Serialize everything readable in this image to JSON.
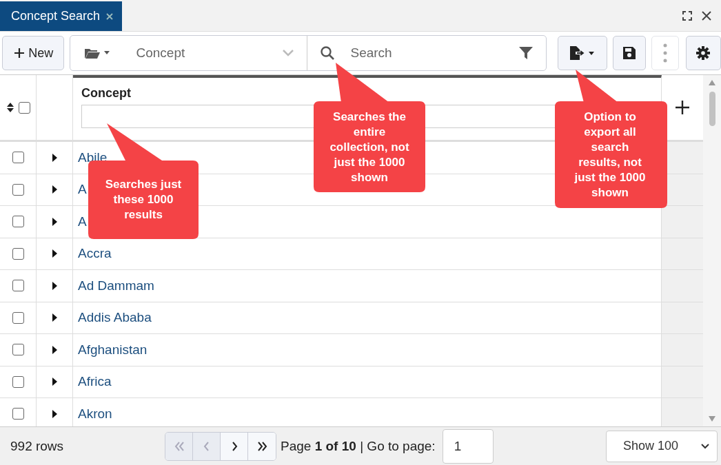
{
  "tabs": [
    {
      "label": "Concept Search",
      "selected": true
    }
  ],
  "toolbar": {
    "new_button": "New",
    "type_select": {
      "value": "Concept"
    },
    "search": {
      "placeholder": "Search"
    }
  },
  "grid": {
    "header_checkbox": {
      "checked": false
    },
    "columns": [
      {
        "title": "Concept"
      }
    ],
    "rows": [
      {
        "concept": "Abile",
        "checked": false,
        "expanded": false
      },
      {
        "concept": "A",
        "checked": false,
        "expanded": false
      },
      {
        "concept": "A",
        "checked": false,
        "expanded": false
      },
      {
        "concept": "Accra",
        "checked": false,
        "expanded": false
      },
      {
        "concept": "Ad Dammam",
        "checked": false,
        "expanded": false
      },
      {
        "concept": "Addis Ababa",
        "checked": false,
        "expanded": false
      },
      {
        "concept": "Afghanistan",
        "checked": false,
        "expanded": false
      },
      {
        "concept": "Africa",
        "checked": false,
        "expanded": false
      },
      {
        "concept": "Akron",
        "checked": false,
        "expanded": false
      }
    ]
  },
  "footer": {
    "row_count": "992 rows",
    "pager": [
      {
        "kind": "first",
        "disabled": true
      },
      {
        "kind": "prev",
        "disabled": true
      },
      {
        "kind": "next",
        "disabled": false
      },
      {
        "kind": "last",
        "disabled": false
      }
    ],
    "page_label": "Page **1 of 10** | Go to page:",
    "page_input": "1",
    "page_size": "Show 100"
  },
  "callouts": [
    {
      "text": "Searches just these 1000 results"
    },
    {
      "text": "Searches the entire collection, not just the 1000 shown"
    },
    {
      "text": "Option to export all search results, not just the 1000 shown"
    }
  ]
}
